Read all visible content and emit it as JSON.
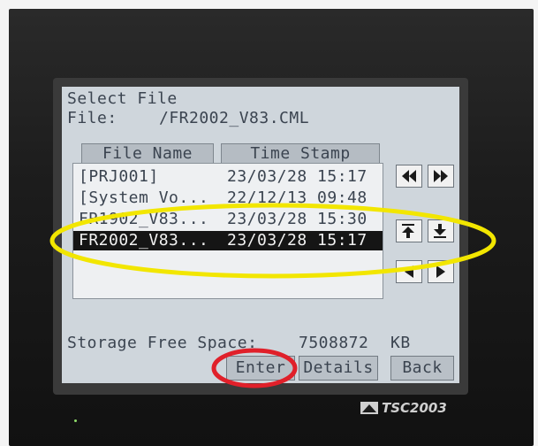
{
  "screen": {
    "title": "Select File",
    "file_label": "File:",
    "file_value": "/FR2002_V83.CML",
    "columns": {
      "name": "File Name",
      "time": "Time Stamp"
    },
    "rows": [
      {
        "name": "[PRJ001]",
        "time": "23/03/28 15:17",
        "selected": false
      },
      {
        "name": "[System Vo...",
        "time": "22/12/13 09:48",
        "selected": false
      },
      {
        "name": "FR1902_V83...",
        "time": "23/03/28 15:30",
        "selected": false
      },
      {
        "name": "FR2002_V83...",
        "time": "23/03/28 15:17",
        "selected": true
      }
    ],
    "storage_label": "Storage Free Space:",
    "storage_value": "7508872",
    "storage_unit": "KB",
    "buttons": {
      "enter": "Enter",
      "details": "Details",
      "back": "Back"
    }
  },
  "device": {
    "model": "TSC2003"
  },
  "colors": {
    "screen_bg": "#cfd6dc",
    "text": "#3b4450",
    "selection_bg": "#151515",
    "annotation_yellow": "#f2e600",
    "annotation_red": "#e0202a"
  },
  "icons": {
    "nav": [
      "first-page-icon",
      "last-page-icon",
      "scroll-top-icon",
      "scroll-bottom-icon",
      "prev-icon",
      "next-icon"
    ]
  }
}
